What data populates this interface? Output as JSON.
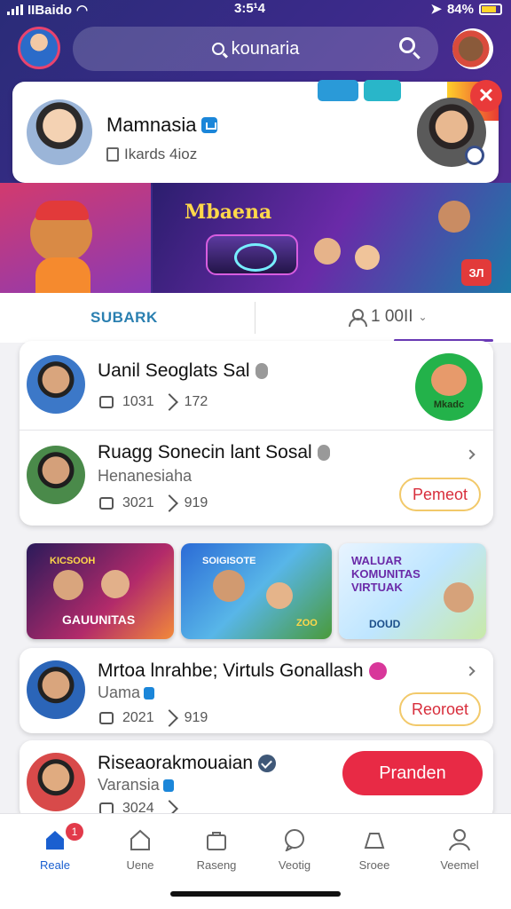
{
  "status_bar": {
    "carrier": "IIBaido",
    "time": "3:5¹4",
    "battery": "84%"
  },
  "search": {
    "text": "kounaria"
  },
  "profile": {
    "name": "Mamnasia",
    "sub": "Ikards 4ioz"
  },
  "banner": {
    "title": "Mbaena",
    "badge": "ЗЛ"
  },
  "tabs": {
    "search": "SUBARK",
    "count": "1 00II"
  },
  "rows": [
    {
      "title": "Uanil Seoglats Sal",
      "comments": "1031",
      "shares": "172",
      "side_label": "Mkadc"
    },
    {
      "title": "Ruagg Sonecin lant Sosal",
      "sub": "Henanesiaha",
      "comments": "3021",
      "shares": "919",
      "action": "Pemeot"
    }
  ],
  "thumbnails": [
    {
      "top": "KICSOOH",
      "caption": "GAUUNITAS"
    },
    {
      "top": "SOIGISOTE",
      "caption": "ZOO"
    },
    {
      "title": "WALUAR KOMUNITAS VIRTUAK",
      "caption": "DOUD"
    }
  ],
  "cards": [
    {
      "title": "Mrtoa lnrahbe; Virtuls Gonallash",
      "sub": "Uama",
      "comments": "2021",
      "shares": "919",
      "action": "Reoroet"
    },
    {
      "title": "Riseaorakmouaian",
      "sub": "Varansia",
      "comments": "3024",
      "action": "Pranden"
    }
  ],
  "bottom_nav": [
    {
      "label": "Reale",
      "badge": "1"
    },
    {
      "label": "Uene"
    },
    {
      "label": "Raseng"
    },
    {
      "label": "Veotig"
    },
    {
      "label": "Sroee"
    },
    {
      "label": "Veemel"
    }
  ],
  "colors": {
    "accent": "#e82a45",
    "brand": "#3b2a8a",
    "active_tab": "#1a5fd0"
  }
}
